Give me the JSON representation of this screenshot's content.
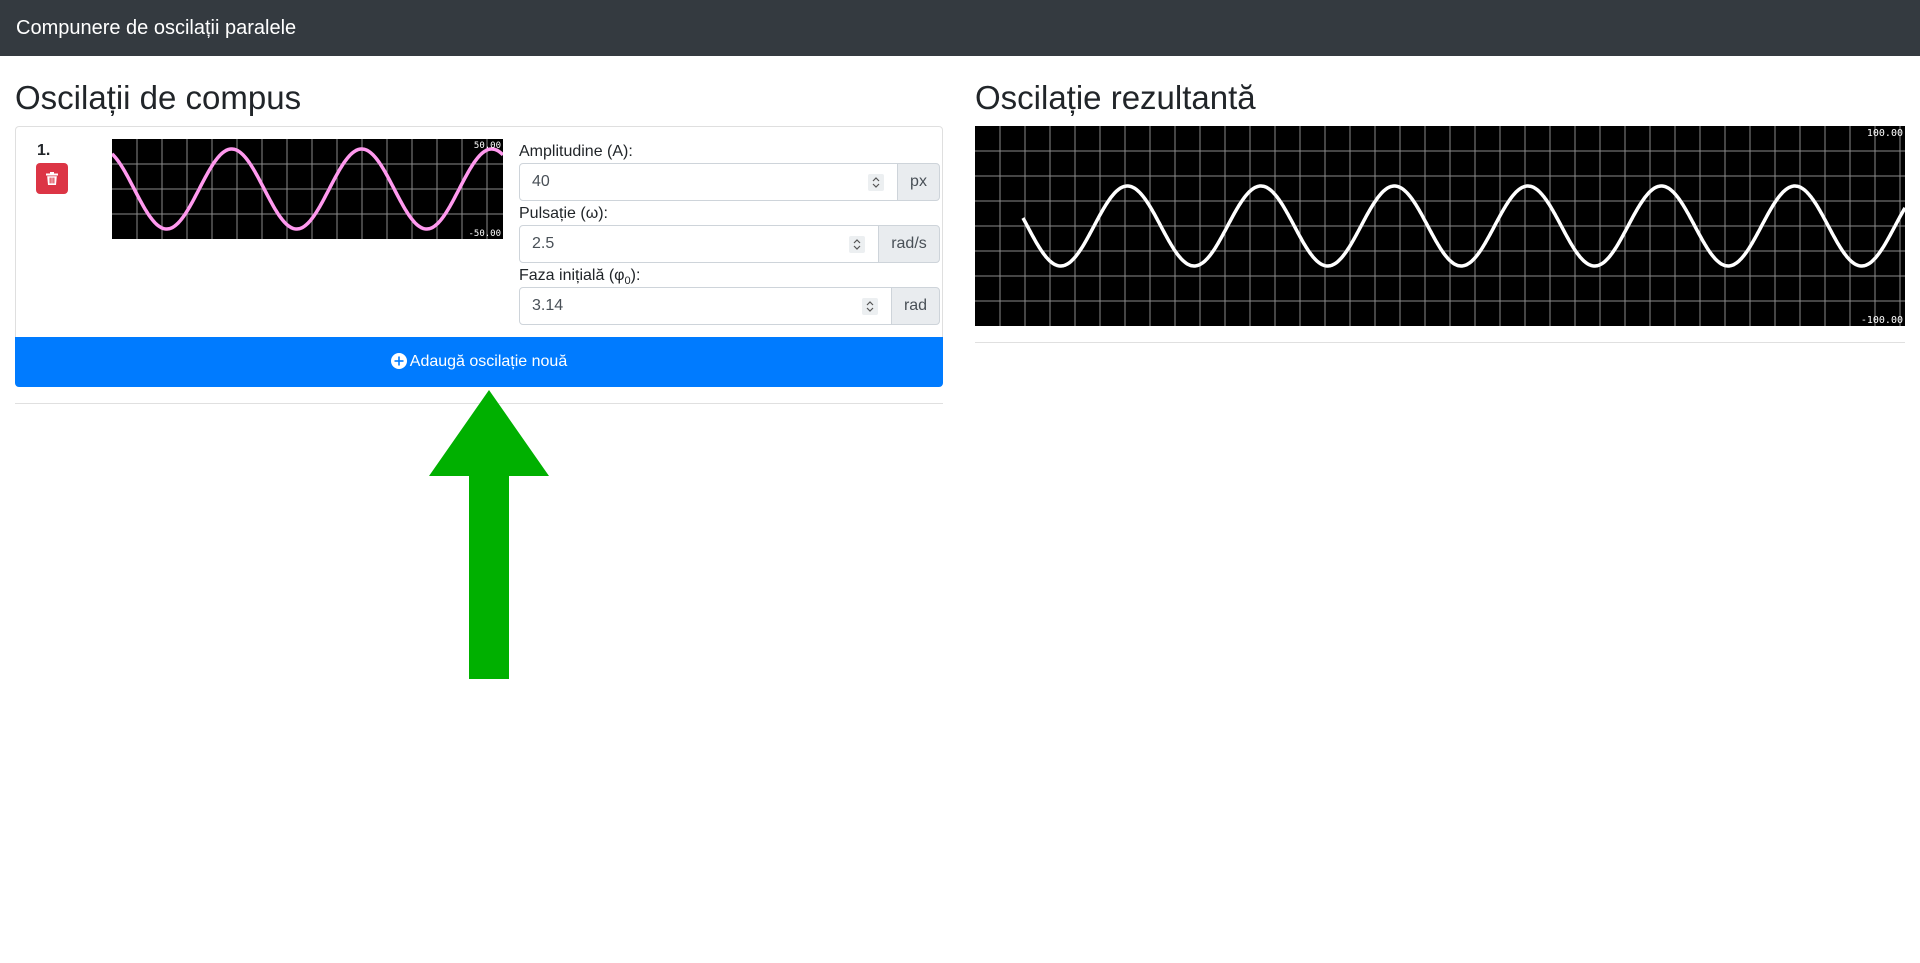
{
  "app": {
    "title": "Compunere de oscilații paralele"
  },
  "left": {
    "heading": "Oscilații de compus",
    "oscillations": [
      {
        "index": "1.",
        "scope": {
          "max_label": "50.00",
          "min_label": "-50.00",
          "line_color": "#ff99ee"
        },
        "amplitude": {
          "label": "Amplitudine (A):",
          "value": "40",
          "unit": "px"
        },
        "pulsation": {
          "label": "Pulsație (ω):",
          "value": "2.5",
          "unit": "rad/s"
        },
        "phase": {
          "label_prefix": "Faza inițială (φ",
          "label_sub": "0",
          "label_suffix": "):",
          "value": "3.14",
          "unit": "rad"
        }
      }
    ],
    "add_button_label": "Adaugă oscilație nouă"
  },
  "right": {
    "heading": "Oscilație rezultantă",
    "scope": {
      "max_label": "100.00",
      "min_label": "-100.00",
      "line_color": "#ffffff"
    }
  },
  "colors": {
    "topbar": "#343a40",
    "primary": "#007bff",
    "danger": "#dc3545",
    "arrow": "#00b000"
  },
  "icons": {
    "delete": "trash-icon",
    "add": "plus-circle-icon",
    "arrow": "arrow-up-icon"
  }
}
